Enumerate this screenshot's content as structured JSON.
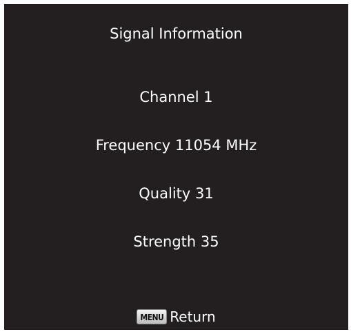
{
  "screen": {
    "title": "Signal Information",
    "background_color": "#231f20",
    "text_color": "#ffffff"
  },
  "info": {
    "channel": "Channel 1",
    "frequency": "Frequency 11054 MHz",
    "quality": "Quality 31",
    "strength": "Strength 35"
  },
  "footer": {
    "menu_key_label": "MENU",
    "menu_key_icon": "menu-key-icon",
    "action_label": "Return"
  }
}
